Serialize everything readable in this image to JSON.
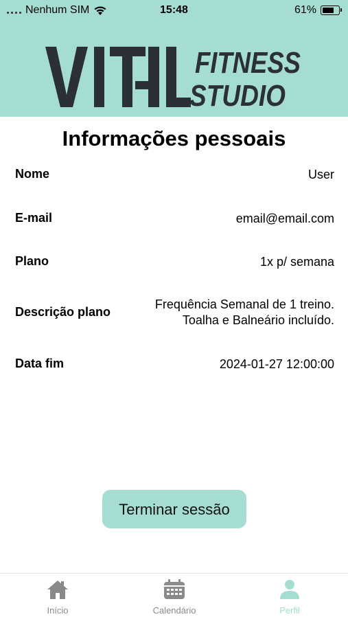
{
  "status_bar": {
    "carrier": "Nenhum SIM",
    "time": "15:48",
    "battery": "61%",
    "battery_level": 0.61
  },
  "brand": {
    "logo_word1": "VITAL",
    "logo_word2": "FITNESS",
    "logo_word3": "STUDIO",
    "header_color": "#a5ddd3",
    "logo_color": "#2b2f38"
  },
  "page": {
    "title": "Informações pessoais"
  },
  "info": {
    "nome_label": "Nome",
    "nome_value": "User",
    "email_label": "E-mail",
    "email_value": "email@email.com",
    "plano_label": "Plano",
    "plano_value": "1x p/ semana",
    "descricao_label": "Descrição plano",
    "descricao_line1": "Frequência Semanal de 1 treino.",
    "descricao_line2": "Toalha e Balneário incluído.",
    "datafim_label": "Data fim",
    "datafim_value": "2024-01-27 12:00:00"
  },
  "actions": {
    "logout_label": "Terminar sessão"
  },
  "tabbar": {
    "tabs": [
      {
        "label": "Início",
        "icon": "home-icon",
        "active": false
      },
      {
        "label": "Calendário",
        "icon": "calendar-icon",
        "active": false
      },
      {
        "label": "Perfil",
        "icon": "person-icon",
        "active": true
      }
    ],
    "active_color": "#a5ddd3",
    "inactive_color": "#8a8a8a"
  }
}
